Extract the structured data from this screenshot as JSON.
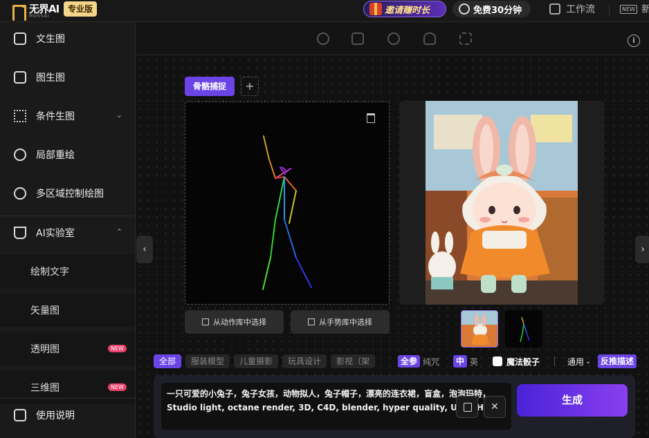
{
  "header": {
    "logo_text": "无界AI",
    "logo_subtext": "MOSSAI",
    "pro_badge": "专业版",
    "invite_label": "邀请赚时长",
    "free_label": "免费30分钟",
    "workflow_label": "工作流",
    "new_label": "新",
    "new_icon_text": "NEW"
  },
  "sidebar": {
    "items": [
      {
        "label": "文生图",
        "icon": "image-icon"
      },
      {
        "label": "图生图",
        "icon": "image-edit-icon"
      },
      {
        "label": "条件生图",
        "icon": "nodes-icon"
      },
      {
        "label": "局部重绘",
        "icon": "partial-repaint-icon"
      },
      {
        "label": "多区域控制绘图",
        "icon": "region-control-icon"
      },
      {
        "label": "AI实验室",
        "icon": "flask-icon"
      }
    ],
    "lab_items": [
      {
        "label": "绘制文字"
      },
      {
        "label": "矢量图"
      },
      {
        "label": "透明图",
        "badge": "NEW"
      },
      {
        "label": "三维图",
        "badge": "NEW"
      }
    ],
    "footer_label": "使用说明"
  },
  "pose": {
    "tab_label": "骨骼捕捉",
    "from_action_lib": "从动作库中选择",
    "from_gesture_lib": "从手势库中选择"
  },
  "styles": {
    "chips": [
      "全部",
      "服装模型",
      "儿童摄影",
      "玩具设计",
      "影视（架"
    ],
    "active_chip": 0,
    "quality_on": "全参",
    "quality_off": "纯咒",
    "lang_on": "中",
    "lang_off": "英",
    "dice_label": "魔法骰子",
    "general_label": "通用",
    "reverse_label": "反推描述"
  },
  "prompt": {
    "text": "一只可爱的小兔子，兔子女孩，动物拟人，兔子帽子，漂亮的连衣裙，盲盒，泡泡玛特，Studio light, octane render, 3D, C4D, blender, hyper quality, Ultra HD"
  },
  "actions": {
    "generate_label": "生成",
    "clear_label": "✕"
  },
  "colors": {
    "accent": "#6b44e6",
    "background": "#141414",
    "invite_text": "#ffe08a",
    "pro_badge_bg": "#f5d58a"
  }
}
